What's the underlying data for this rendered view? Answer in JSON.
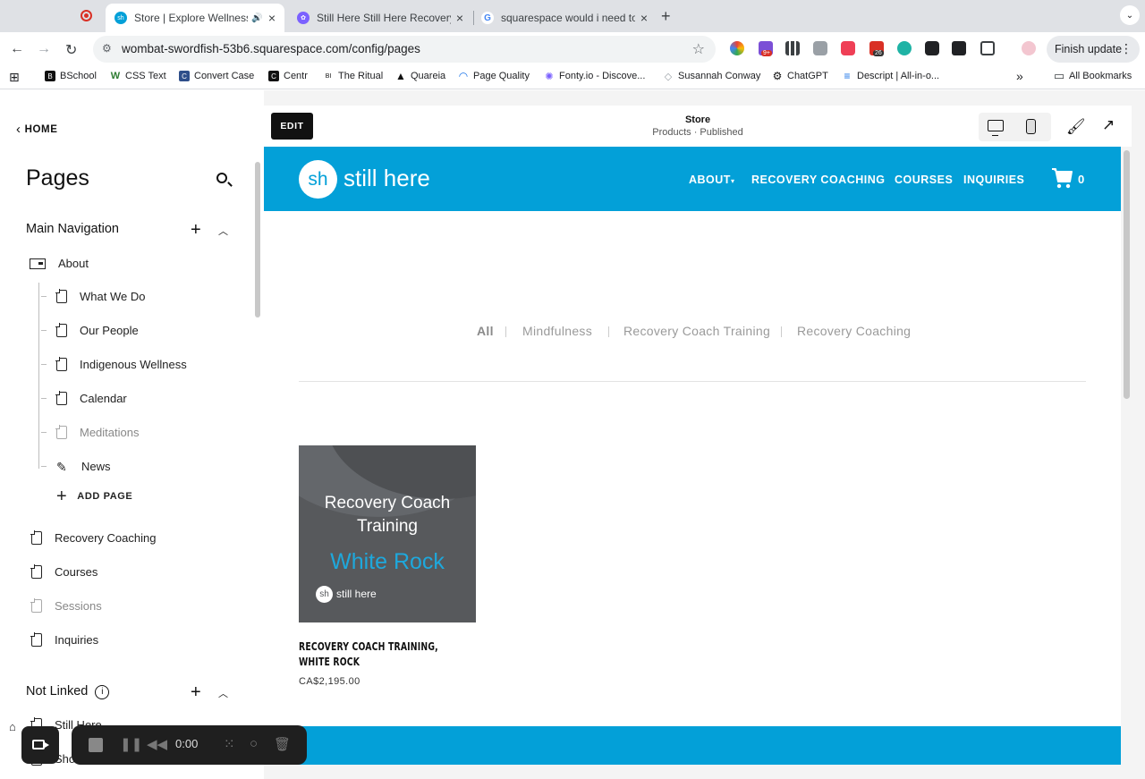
{
  "browser": {
    "tabs": [
      {
        "label": "Store | Explore Wellness (",
        "active": true,
        "favicon": "sh"
      },
      {
        "label": "Still Here Still Here Recovery",
        "active": false,
        "favicon": "flower"
      },
      {
        "label": "squarespace would i need to",
        "active": false,
        "favicon": "G"
      }
    ],
    "url": "wombat-swordfish-53b6.squarespace.com/config/pages",
    "finish_update": "Finish update",
    "extension_badges": {
      "badge_a": "9+",
      "badge_b": "26"
    },
    "bookmarks": [
      {
        "label": "BSchool",
        "icon": "BS"
      },
      {
        "label": "CSS Text",
        "icon": "W"
      },
      {
        "label": "Convert Case",
        "icon": "CC"
      },
      {
        "label": "Centr",
        "icon": "C"
      },
      {
        "label": "The Ritual",
        "icon": "BI"
      },
      {
        "label": "Quareia",
        "icon": "A"
      },
      {
        "label": "Page Quality",
        "icon": "PQ"
      },
      {
        "label": "Fonty.io - Discove...",
        "icon": "F"
      },
      {
        "label": "Susannah Conway",
        "icon": "SC"
      },
      {
        "label": "ChatGPT",
        "icon": "GPT"
      },
      {
        "label": "Descript | All-in-o...",
        "icon": "D"
      }
    ],
    "all_bookmarks": "All Bookmarks"
  },
  "panel": {
    "home_label": "HOME",
    "title": "Pages",
    "main_nav_title": "Main Navigation",
    "about": "About",
    "about_children": [
      {
        "label": "What We Do",
        "muted": false
      },
      {
        "label": "Our People",
        "muted": false
      },
      {
        "label": "Indigenous Wellness",
        "muted": false
      },
      {
        "label": "Calendar",
        "muted": false
      },
      {
        "label": "Meditations",
        "muted": true
      },
      {
        "label": "News",
        "muted": false
      }
    ],
    "add_page": "ADD PAGE",
    "top_pages": [
      {
        "label": "Recovery Coaching",
        "muted": false
      },
      {
        "label": "Courses",
        "muted": false
      },
      {
        "label": "Sessions",
        "muted": true
      },
      {
        "label": "Inquiries",
        "muted": false
      }
    ],
    "not_linked_title": "Not Linked",
    "not_linked_pages": [
      "Still Here",
      "Sho"
    ]
  },
  "preview": {
    "edit_label": "EDIT",
    "page_title": "Store",
    "page_subtitle": "Products · Published"
  },
  "site": {
    "logo_mark": "sh",
    "logo_text": "still here",
    "nav": [
      "ABOUT",
      "RECOVERY COACHING",
      "COURSES",
      "INQUIRIES"
    ],
    "cart_count": "0",
    "filters": [
      "All",
      "Mindfulness",
      "Recovery Coach Training",
      "Recovery Coaching"
    ],
    "product": {
      "image_line1": "Recovery Coach",
      "image_line2": "Training",
      "image_line3": "White Rock",
      "image_logo_mark": "sh",
      "image_logo_text": "still here",
      "name": "RECOVERY COACH TRAINING, WHITE ROCK",
      "price": "CA$2,195.00"
    },
    "colors": {
      "brand": "#03a0d8",
      "image_bg": "#57595c"
    }
  },
  "recorder": {
    "time": "0:00"
  }
}
